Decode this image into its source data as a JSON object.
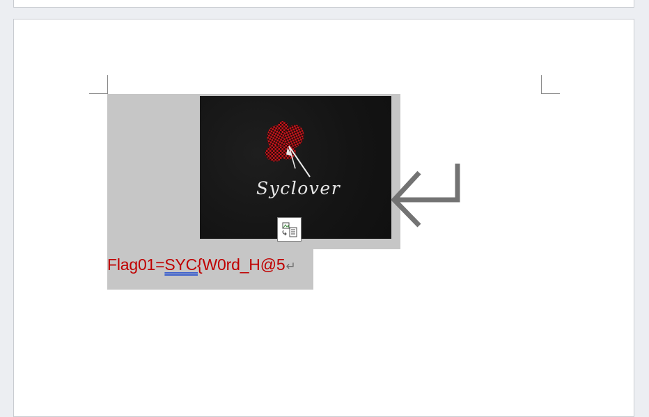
{
  "document": {
    "image": {
      "logo_text": "Syclover",
      "layout_options_icon": "layout-options-icon"
    },
    "flag_line": {
      "prefix": "Flag01=",
      "underlined": "SYC{",
      "rest": "W0rd_H@5",
      "paragraph_mark": "↵"
    },
    "big_return_icon": "return-arrow-icon"
  },
  "colors": {
    "flag_text": "#c00000",
    "selection": "#c6c6c6",
    "page": "#ffffff",
    "workspace": "#eceef2",
    "spell_underline": "#3a5fcd"
  }
}
